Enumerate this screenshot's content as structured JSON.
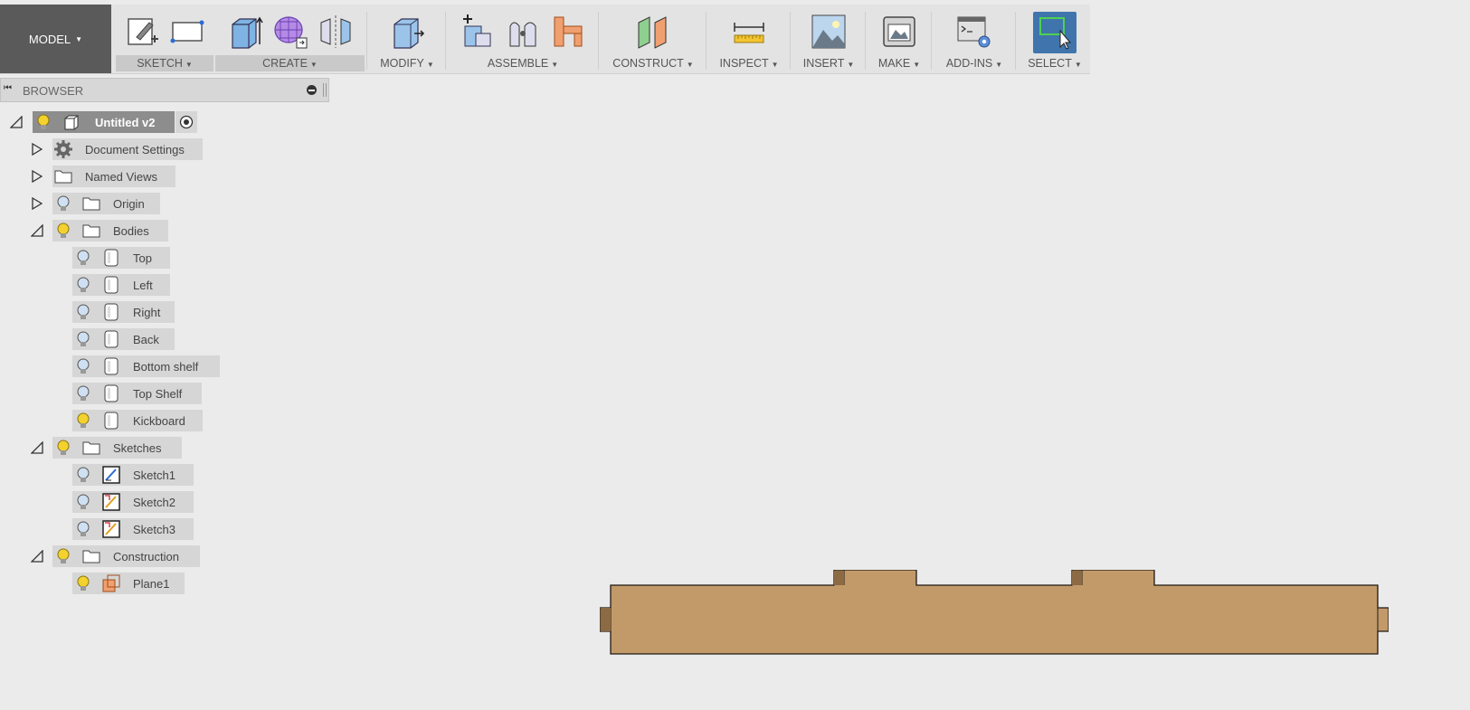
{
  "toolbar": {
    "workspace": "MODEL",
    "groups": [
      {
        "id": "sketch",
        "label": "SKETCH"
      },
      {
        "id": "create",
        "label": "CREATE"
      },
      {
        "id": "modify",
        "label": "MODIFY"
      },
      {
        "id": "assemble",
        "label": "ASSEMBLE"
      },
      {
        "id": "construct",
        "label": "CONSTRUCT"
      },
      {
        "id": "inspect",
        "label": "INSPECT"
      },
      {
        "id": "insert",
        "label": "INSERT"
      },
      {
        "id": "make",
        "label": "MAKE"
      },
      {
        "id": "addins",
        "label": "ADD-INS"
      },
      {
        "id": "select",
        "label": "SELECT"
      }
    ]
  },
  "browser": {
    "title": "BROWSER",
    "root": "Untitled v2",
    "items": [
      {
        "label": "Document Settings"
      },
      {
        "label": "Named Views"
      },
      {
        "label": "Origin"
      },
      {
        "label": "Bodies"
      },
      {
        "label": "Top"
      },
      {
        "label": "Left"
      },
      {
        "label": "Right"
      },
      {
        "label": "Back"
      },
      {
        "label": "Bottom shelf"
      },
      {
        "label": "Top Shelf"
      },
      {
        "label": "Kickboard"
      },
      {
        "label": "Sketches"
      },
      {
        "label": "Sketch1"
      },
      {
        "label": "Sketch2"
      },
      {
        "label": "Sketch3"
      },
      {
        "label": "Construction"
      },
      {
        "label": "Plane1"
      }
    ]
  },
  "colors": {
    "accent": "#3f75ac",
    "bulb_on": "#f3d22f",
    "bulb_off": "#cfe0f2",
    "wood": "#c29a6a"
  }
}
